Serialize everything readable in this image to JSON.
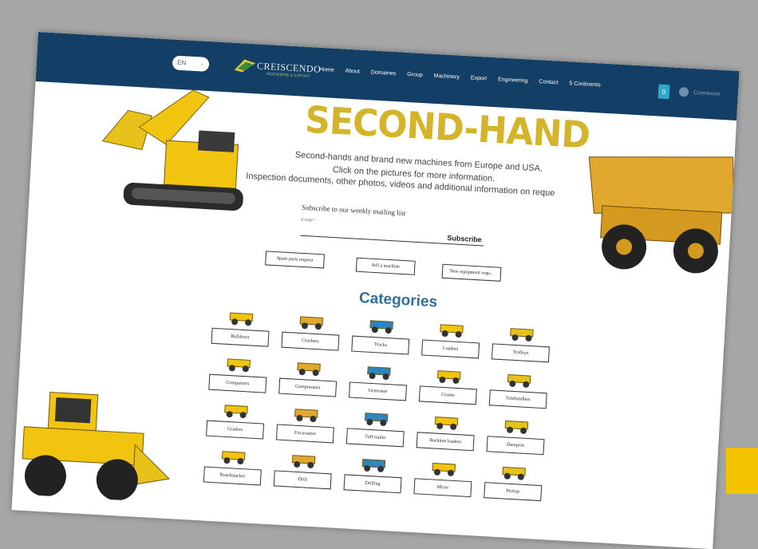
{
  "header": {
    "language": "EN",
    "logo": {
      "name": "CREISCENDO",
      "tagline": "INGENIERIE & EXPORT"
    },
    "nav": [
      "Home",
      "About",
      "Domaines",
      "Group",
      "Machinery",
      "Export",
      "Engineering",
      "Contact",
      "5 Continents"
    ],
    "cart_count": "0",
    "login_label": "Connexion"
  },
  "hero": {
    "title": "SECOND-HAND",
    "line1": "Second-hands and brand new machines from Europe and USA.",
    "line2": "Click on the pictures for more information.",
    "line3": "Inspection documents, other photos, videos and additional information on reque"
  },
  "newsletter": {
    "label": "Subscribe to our weekly mailing list",
    "email_label": "E-mail *",
    "button": "Subscribe"
  },
  "actions": [
    "Spare parts request",
    "Sell a machine",
    "New equipment requ..."
  ],
  "categories_title": "Categories",
  "categories": [
    "Bulldozer",
    "Crushers",
    "Trucks",
    "Loaders",
    "Trolleys",
    "Compactors",
    "Compressors",
    "Generator",
    "Cranes",
    "Telehandlers",
    "Graders",
    "Excavators",
    "Tuff trailer",
    "Backhoe loaders",
    "Dumpers",
    "Reachstacker",
    "Drill",
    "Drilling",
    "Mixer",
    "Pickup"
  ],
  "colors": {
    "navbar": "#133f66",
    "title_yellow": "#d4b42a",
    "category_blue": "#2f6f9f",
    "machine_yellow": "#f1c40f"
  },
  "icons": {
    "cart": "shopping-bag-icon",
    "user": "user-avatar-icon",
    "lang": "chevron-down-icon"
  }
}
